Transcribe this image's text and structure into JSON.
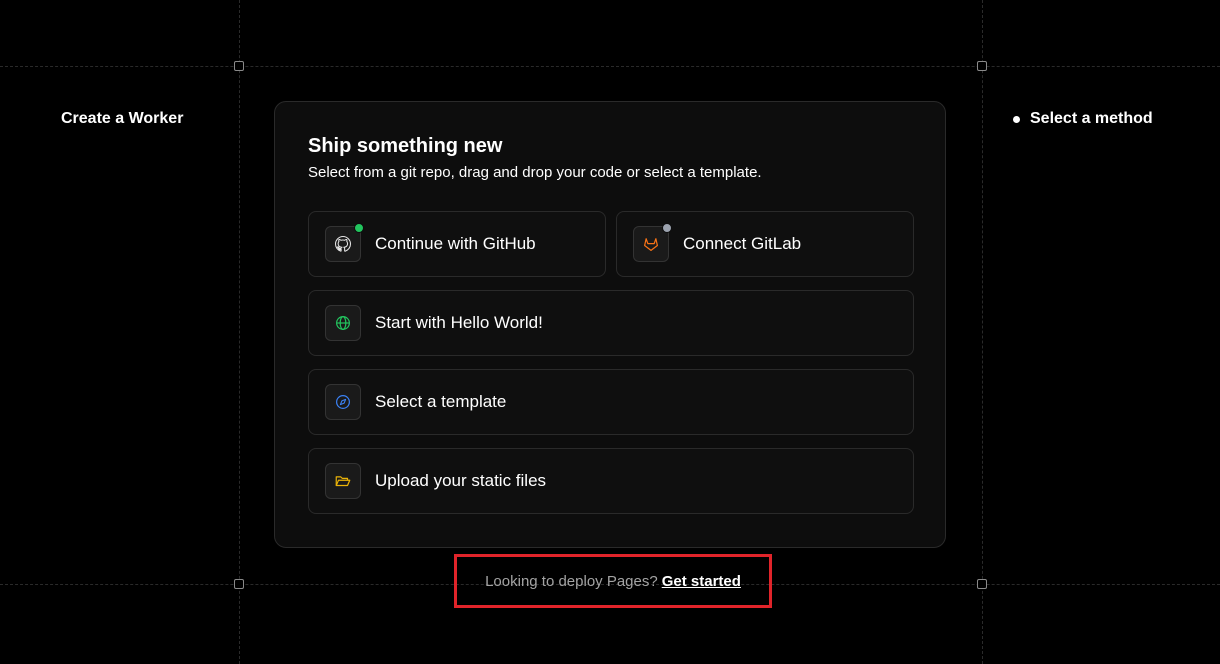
{
  "sidebar": {
    "title": "Create a Worker"
  },
  "steps": {
    "current": "Select a method"
  },
  "card": {
    "title": "Ship something new",
    "subtitle": "Select from a git repo, drag and drop your code or select a template."
  },
  "options": {
    "github": {
      "label": "Continue with GitHub",
      "icon": "github-icon",
      "status_color": "#22c55e"
    },
    "gitlab": {
      "label": "Connect GitLab",
      "icon": "gitlab-icon",
      "status_color": "#9ca3af"
    },
    "hello_world": {
      "label": "Start with Hello World!",
      "icon": "globe-icon",
      "icon_color": "#22c55e"
    },
    "template": {
      "label": "Select a template",
      "icon": "compass-icon",
      "icon_color": "#3b82f6"
    },
    "upload": {
      "label": "Upload your static files",
      "icon": "folder-open-icon",
      "icon_color": "#eab308"
    }
  },
  "footer": {
    "text": "Looking to deploy Pages?",
    "link": "Get started",
    "highlight_color": "#e0242a"
  }
}
